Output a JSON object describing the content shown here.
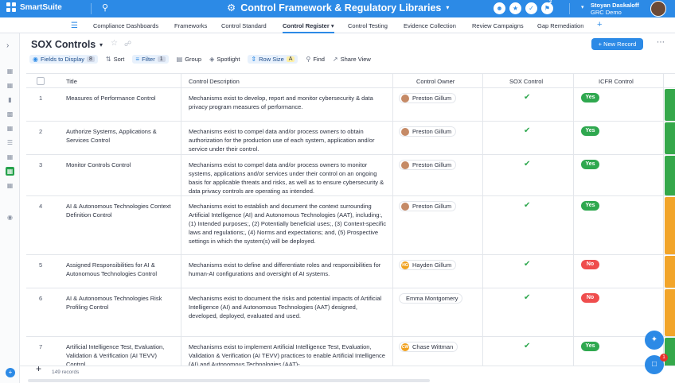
{
  "app": {
    "brand": "SmartSuite",
    "workspace_title": "Control Framework & Regulatory Libraries",
    "notification_count": "2"
  },
  "user": {
    "name": "Stoyan Daskaloff",
    "org": "GRC Demo"
  },
  "tabs": [
    {
      "label": "Compliance Dashboards"
    },
    {
      "label": "Frameworks"
    },
    {
      "label": "Control Standard"
    },
    {
      "label": "Control Register",
      "active": true
    },
    {
      "label": "Control Testing"
    },
    {
      "label": "Evidence Collection"
    },
    {
      "label": "Review Campaigns"
    },
    {
      "label": "Gap Remediation"
    }
  ],
  "view": {
    "title": "SOX Controls",
    "new_record_label": "+ New Record"
  },
  "toolbar": {
    "fields_label": "Fields to Display",
    "fields_count": "8",
    "sort_label": "Sort",
    "filter_label": "Filter",
    "filter_count": "1",
    "group_label": "Group",
    "spotlight_label": "Spotlight",
    "rowsize_label": "Row Size",
    "rowsize_value": "A",
    "find_label": "Find",
    "share_label": "Share View"
  },
  "columns": {
    "title": "Title",
    "description": "Control Description",
    "owner": "Control Owner",
    "sox": "SOX Control",
    "icfr": "ICFR Control"
  },
  "rows": [
    {
      "num": "1",
      "title": "Measures of Performance Control",
      "description": "Mechanisms exist to develop, report and monitor cybersecurity & data privacy program measures of performance.",
      "owner": "Preston Gillum",
      "owner_initials": "",
      "sox": true,
      "icfr": "Yes",
      "status_color": "#35a84a"
    },
    {
      "num": "2",
      "title": "Authorize Systems, Applications & Services Control",
      "description": "Mechanisms exist to compel data and/or process owners to obtain authorization for the production use of each system, application and/or service under their control.",
      "owner": "Preston Gillum",
      "owner_initials": "",
      "sox": true,
      "icfr": "Yes",
      "status_color": "#35a84a"
    },
    {
      "num": "3",
      "title": "Monitor Controls Control",
      "description": "Mechanisms exist to compel data and/or process owners to monitor systems, applications and/or services under their control on an ongoing basis for applicable threats and risks, as well as to ensure cybersecurity & data privacy controls are operating as intended.",
      "owner": "Preston Gillum",
      "owner_initials": "",
      "sox": true,
      "icfr": "Yes",
      "status_color": "#35a84a"
    },
    {
      "num": "4",
      "title": "AI & Autonomous Technologies Context Definition Control",
      "description": "Mechanisms exist to establish and document the context surrounding Artificial Intelligence (AI) and Autonomous Technologies (AAT), including:, (1) Intended purposes;, (2) Potentially beneficial uses;, (3) Context-specific laws and regulations;, (4) Norms and expectations; and, (5) Prospective settings in which the system(s) will be deployed.",
      "owner": "Preston Gillum",
      "owner_initials": "",
      "sox": true,
      "icfr": "Yes",
      "status_color": "#f2a52a"
    },
    {
      "num": "5",
      "title": "Assigned Responsibilities for AI & Autonomous Technologies Control",
      "description": "Mechanisms exist to define and differentiate roles and responsibilities for human-AI configurations and oversight of AI systems.",
      "owner": "Hayden Gillum",
      "owner_initials": "HG",
      "sox": true,
      "icfr": "No",
      "status_color": "#f2a52a"
    },
    {
      "num": "6",
      "title": "AI & Autonomous Technologies Risk Profiling Control",
      "description": "Mechanisms exist to document the risks and potential impacts of Artificial Intelligence (AI) and Autonomous Technologies (AAT) designed, developed, deployed, evaluated and used.",
      "owner": "Emma Montgomery",
      "owner_initials": "-",
      "sox": true,
      "icfr": "No",
      "status_color": "#f2a52a"
    },
    {
      "num": "7",
      "title": "Artificial Intelligence Test, Evaluation, Validation & Verification (AI TEVV) Control",
      "description": "Mechanisms exist to implement Artificial Intelligence Test, Evaluation, Validation & Verification (AI TEVV) practices to enable Artificial Intelligence (AI) and Autonomous Technologies (AAT)-",
      "owner": "Chase Wittman",
      "owner_initials": "CW",
      "sox": true,
      "icfr": "Yes",
      "status_color": "#35a84a"
    }
  ],
  "footer": {
    "record_count": "149 records"
  },
  "chat_badge": "1"
}
